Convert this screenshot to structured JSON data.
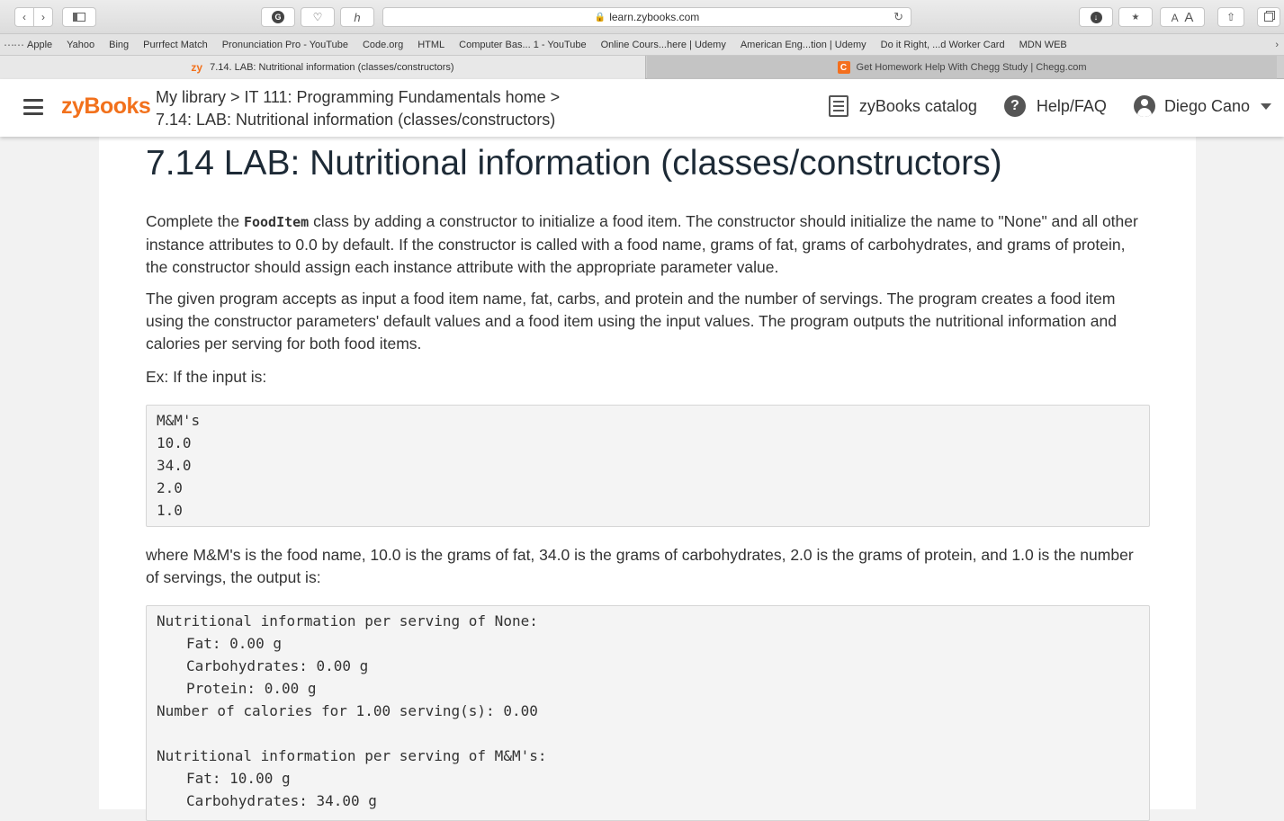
{
  "browser": {
    "url": "learn.zybooks.com",
    "bookmarks": [
      "Apple",
      "Yahoo",
      "Bing",
      "Purrfect Match",
      "Pronunciation Pro - YouTube",
      "Code.org",
      "HTML",
      "Computer Bas... 1 - YouTube",
      "Online Cours...here | Udemy",
      "American Eng...tion | Udemy",
      "Do it Right, ...d Worker Card",
      "MDN WEB"
    ],
    "tabs": [
      {
        "label": "7.14. LAB: Nutritional information (classes/constructors)",
        "favicon": "zy"
      },
      {
        "label": "Get Homework Help With Chegg Study | Chegg.com",
        "favicon": "C"
      }
    ]
  },
  "header": {
    "logo": "zyBooks",
    "breadcrumb_line1": "My library > IT 111: Programming Fundamentals home >",
    "breadcrumb_line2": "7.14: LAB: Nutritional information (classes/constructors)",
    "catalog_label": "zyBooks catalog",
    "help_label": "Help/FAQ",
    "user_name": "Diego Cano"
  },
  "content": {
    "title": "7.14 LAB: Nutritional information (classes/constructors)",
    "para1_pre": "Complete the ",
    "para1_code": "FoodItem",
    "para1_post": " class by adding a constructor to initialize a food item. The constructor should initialize the name to \"None\" and all other instance attributes to 0.0 by default. If the constructor is called with a food name, grams of fat, grams of carbohydrates, and grams of protein, the constructor should assign each instance attribute with the appropriate parameter value.",
    "para2": "The given program accepts as input a food item name, fat, carbs, and protein and the number of servings. The program creates a food item using the constructor parameters' default values and a food item using the input values. The program outputs the nutritional information and calories per serving for both food items.",
    "para3": "Ex: If the input is:",
    "input_lines": [
      "M&M's",
      "10.0",
      "34.0",
      "2.0",
      "1.0"
    ],
    "para4": "where M&M's is the food name, 10.0 is the grams of fat, 34.0 is the grams of carbohydrates, 2.0 is the grams of protein, and 1.0 is the number of servings, the output is:",
    "output_lines": [
      "Nutritional information per serving of None:",
      "Fat: 0.00 g",
      "Carbohydrates: 0.00 g",
      "Protein: 0.00 g",
      "Number of calories for 1.00 serving(s): 0.00",
      "",
      "Nutritional information per serving of M&M's:",
      "Fat: 10.00 g",
      "Carbohydrates: 34.00 g"
    ]
  }
}
